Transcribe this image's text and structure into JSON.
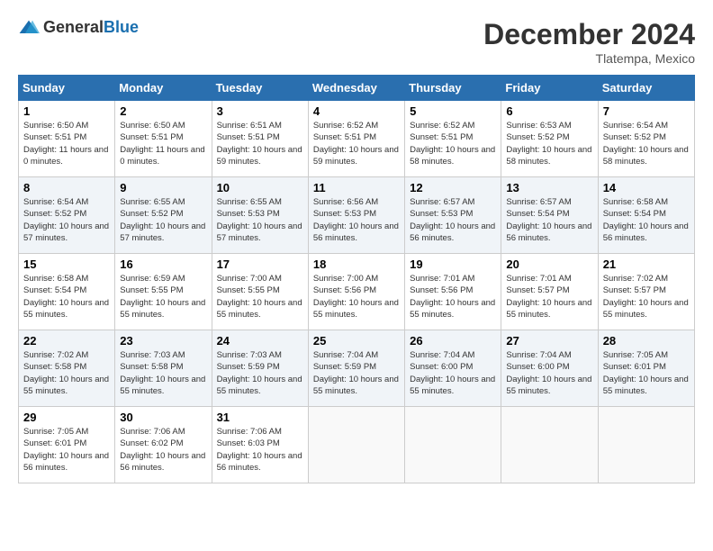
{
  "header": {
    "logo_general": "General",
    "logo_blue": "Blue",
    "month_title": "December 2024",
    "location": "Tlatempa, Mexico"
  },
  "calendar": {
    "days_of_week": [
      "Sunday",
      "Monday",
      "Tuesday",
      "Wednesday",
      "Thursday",
      "Friday",
      "Saturday"
    ],
    "weeks": [
      [
        {
          "day": "1",
          "info": "Sunrise: 6:50 AM\nSunset: 5:51 PM\nDaylight: 11 hours and 0 minutes."
        },
        {
          "day": "2",
          "info": "Sunrise: 6:50 AM\nSunset: 5:51 PM\nDaylight: 11 hours and 0 minutes."
        },
        {
          "day": "3",
          "info": "Sunrise: 6:51 AM\nSunset: 5:51 PM\nDaylight: 10 hours and 59 minutes."
        },
        {
          "day": "4",
          "info": "Sunrise: 6:52 AM\nSunset: 5:51 PM\nDaylight: 10 hours and 59 minutes."
        },
        {
          "day": "5",
          "info": "Sunrise: 6:52 AM\nSunset: 5:51 PM\nDaylight: 10 hours and 58 minutes."
        },
        {
          "day": "6",
          "info": "Sunrise: 6:53 AM\nSunset: 5:52 PM\nDaylight: 10 hours and 58 minutes."
        },
        {
          "day": "7",
          "info": "Sunrise: 6:54 AM\nSunset: 5:52 PM\nDaylight: 10 hours and 58 minutes."
        }
      ],
      [
        {
          "day": "8",
          "info": "Sunrise: 6:54 AM\nSunset: 5:52 PM\nDaylight: 10 hours and 57 minutes."
        },
        {
          "day": "9",
          "info": "Sunrise: 6:55 AM\nSunset: 5:52 PM\nDaylight: 10 hours and 57 minutes."
        },
        {
          "day": "10",
          "info": "Sunrise: 6:55 AM\nSunset: 5:53 PM\nDaylight: 10 hours and 57 minutes."
        },
        {
          "day": "11",
          "info": "Sunrise: 6:56 AM\nSunset: 5:53 PM\nDaylight: 10 hours and 56 minutes."
        },
        {
          "day": "12",
          "info": "Sunrise: 6:57 AM\nSunset: 5:53 PM\nDaylight: 10 hours and 56 minutes."
        },
        {
          "day": "13",
          "info": "Sunrise: 6:57 AM\nSunset: 5:54 PM\nDaylight: 10 hours and 56 minutes."
        },
        {
          "day": "14",
          "info": "Sunrise: 6:58 AM\nSunset: 5:54 PM\nDaylight: 10 hours and 56 minutes."
        }
      ],
      [
        {
          "day": "15",
          "info": "Sunrise: 6:58 AM\nSunset: 5:54 PM\nDaylight: 10 hours and 55 minutes."
        },
        {
          "day": "16",
          "info": "Sunrise: 6:59 AM\nSunset: 5:55 PM\nDaylight: 10 hours and 55 minutes."
        },
        {
          "day": "17",
          "info": "Sunrise: 7:00 AM\nSunset: 5:55 PM\nDaylight: 10 hours and 55 minutes."
        },
        {
          "day": "18",
          "info": "Sunrise: 7:00 AM\nSunset: 5:56 PM\nDaylight: 10 hours and 55 minutes."
        },
        {
          "day": "19",
          "info": "Sunrise: 7:01 AM\nSunset: 5:56 PM\nDaylight: 10 hours and 55 minutes."
        },
        {
          "day": "20",
          "info": "Sunrise: 7:01 AM\nSunset: 5:57 PM\nDaylight: 10 hours and 55 minutes."
        },
        {
          "day": "21",
          "info": "Sunrise: 7:02 AM\nSunset: 5:57 PM\nDaylight: 10 hours and 55 minutes."
        }
      ],
      [
        {
          "day": "22",
          "info": "Sunrise: 7:02 AM\nSunset: 5:58 PM\nDaylight: 10 hours and 55 minutes."
        },
        {
          "day": "23",
          "info": "Sunrise: 7:03 AM\nSunset: 5:58 PM\nDaylight: 10 hours and 55 minutes."
        },
        {
          "day": "24",
          "info": "Sunrise: 7:03 AM\nSunset: 5:59 PM\nDaylight: 10 hours and 55 minutes."
        },
        {
          "day": "25",
          "info": "Sunrise: 7:04 AM\nSunset: 5:59 PM\nDaylight: 10 hours and 55 minutes."
        },
        {
          "day": "26",
          "info": "Sunrise: 7:04 AM\nSunset: 6:00 PM\nDaylight: 10 hours and 55 minutes."
        },
        {
          "day": "27",
          "info": "Sunrise: 7:04 AM\nSunset: 6:00 PM\nDaylight: 10 hours and 55 minutes."
        },
        {
          "day": "28",
          "info": "Sunrise: 7:05 AM\nSunset: 6:01 PM\nDaylight: 10 hours and 55 minutes."
        }
      ],
      [
        {
          "day": "29",
          "info": "Sunrise: 7:05 AM\nSunset: 6:01 PM\nDaylight: 10 hours and 56 minutes."
        },
        {
          "day": "30",
          "info": "Sunrise: 7:06 AM\nSunset: 6:02 PM\nDaylight: 10 hours and 56 minutes."
        },
        {
          "day": "31",
          "info": "Sunrise: 7:06 AM\nSunset: 6:03 PM\nDaylight: 10 hours and 56 minutes."
        },
        {
          "day": "",
          "info": ""
        },
        {
          "day": "",
          "info": ""
        },
        {
          "day": "",
          "info": ""
        },
        {
          "day": "",
          "info": ""
        }
      ]
    ]
  }
}
